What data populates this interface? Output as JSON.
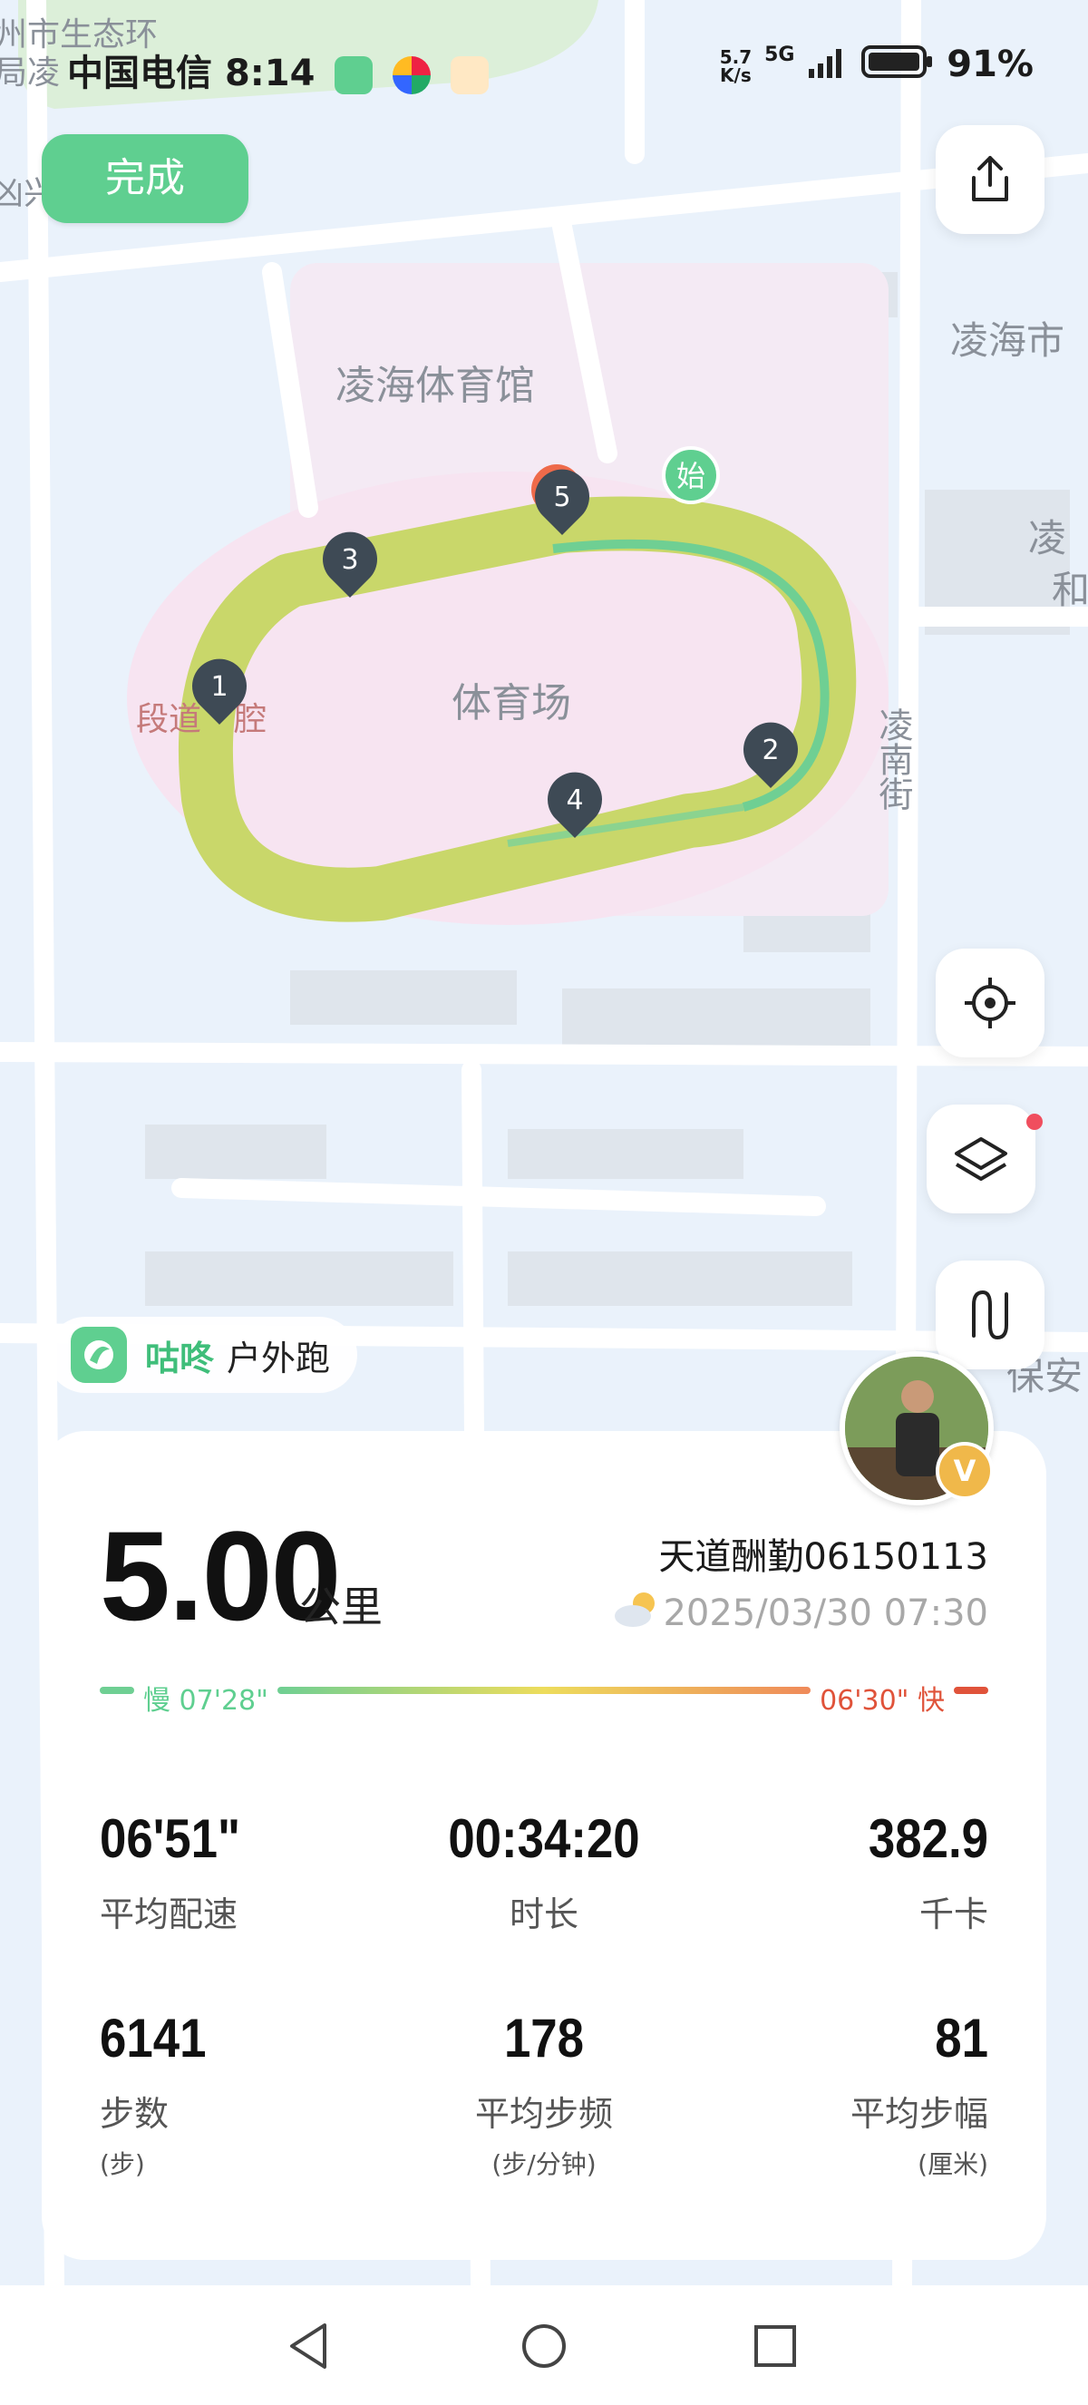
{
  "status_bar": {
    "carrier": "中国电信",
    "time": "8:14",
    "net_speed_top": "5.7",
    "net_speed_bottom": "K/s",
    "network": "5G",
    "battery": "91%"
  },
  "map": {
    "labels": {
      "top_left_1": "州市生态环",
      "top_left_2": "局凌",
      "side_left": "凶兴",
      "gym": "凌海体育馆",
      "stadium": "体育场",
      "clinic": "段道　腔",
      "street": "凌南街",
      "right_top": "凌海市",
      "right_mid_1": "凌",
      "right_mid_2": "和",
      "right_bottom": "保安"
    },
    "markers": [
      "1",
      "2",
      "3",
      "4",
      "5"
    ],
    "start_marker": "始"
  },
  "header": {
    "done_label": "完成"
  },
  "icons": {
    "share": "share-icon",
    "locate": "locate-icon",
    "layers": "layers-icon",
    "route": "route-icon"
  },
  "brand": {
    "name": "咕咚",
    "activity": "户外跑"
  },
  "summary": {
    "distance": "5.00",
    "distance_unit": "公里",
    "username": "天道酬勤06150113",
    "datetime": "2025/03/30 07:30",
    "pace_slow_label": "慢 07'28\"",
    "pace_fast_label": "06'30\" 快"
  },
  "stats": [
    {
      "value": "06'51\"",
      "label": "平均配速",
      "unit": ""
    },
    {
      "value": "00:34:20",
      "label": "时长",
      "unit": ""
    },
    {
      "value": "382.9",
      "label": "千卡",
      "unit": ""
    },
    {
      "value": "6141",
      "label": "步数",
      "unit": "(步)"
    },
    {
      "value": "178",
      "label": "平均步频",
      "unit": "(步/分钟)"
    },
    {
      "value": "81",
      "label": "平均步幅",
      "unit": "(厘米)"
    }
  ],
  "colors": {
    "accent": "#5fcf90",
    "route": "#cbd86a",
    "fast": "#e0533a",
    "marker": "#3e4a55"
  }
}
